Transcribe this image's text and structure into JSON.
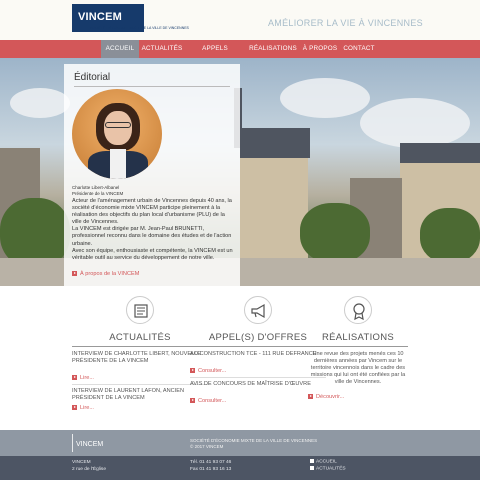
{
  "header": {
    "logo_text": "VINCEM",
    "logo_subtitle": "SOCIÉTÉ D'ÉCONOMIE MIXTE DE LA VILLE DE VINCENNES",
    "tagline": "AMÉLIORER LA VIE À VINCENNES"
  },
  "nav": {
    "items": [
      {
        "label": "ACCUEIL"
      },
      {
        "label": "ACTUALITÉS"
      },
      {
        "label": "APPELS D'OFFRES"
      },
      {
        "label": "RÉALISATIONS"
      },
      {
        "label": "À PROPOS"
      },
      {
        "label": "CONTACT"
      }
    ]
  },
  "editorial": {
    "title": "Éditorial",
    "caption_name": "Charlotte Libert-Albanel",
    "caption_role": "Présidente de la VINCEM",
    "body_1": "Acteur de l'aménagement urbain de Vincennes depuis 40 ans, la société d'économie mixte VINCEM participe pleinement à la réalisation des objectifs du plan local d'urbanisme (PLU) de la ville de Vincennes.",
    "body_2": "La VINCEM est dirigée par M. Jean-Paul BRUNETTI, professionnel reconnu dans le domaine des études et de l'action urbaine.",
    "body_3": "Avec son équipe, enthousiaste et compétente, la VINCEM  est un véritable outil au service du développement de notre ville.",
    "link": "À propos de la VINCEM"
  },
  "columns": {
    "actualites": {
      "title": "ACTUALITÉS",
      "items": [
        {
          "text": "INTERVIEW DE CHARLOTTE LIBERT, NOUVELLE PRÉSIDENTE DE LA VINCEM",
          "link": "Lire..."
        },
        {
          "text": "INTERVIEW DE LAURENT LAFON, ANCIEN PRÉSIDENT DE LA VINCEM",
          "link": "Lire..."
        }
      ]
    },
    "appels": {
      "title": "APPEL(S) D'OFFRES",
      "items": [
        {
          "text": "AO CONSTRUCTION TCE - 111 RUE DEFRANCE",
          "link": "Consulter..."
        },
        {
          "text": "AVIS DE CONCOURS DE MAÎTRISE D'ŒUVRE",
          "link": "Consulter..."
        }
      ]
    },
    "realisations": {
      "title": "RÉALISATIONS",
      "text": "Une revue des projets menés ces 10 dernières années par Vincem sur le territoire vincennois dans le cadre des missions qui lui ont été confiées par la ville de Vincennes.",
      "link": "Découvrir..."
    }
  },
  "footer": {
    "logo_text": "VINCEM",
    "company_line": "SOCIÉTÉ D'ÉCONOMIE MIXTE DE LA VILLE DE VINCENNES",
    "copyright": "© 2017 VINCEM",
    "address_1": "VINCEM",
    "address_2": "2 rue de l'Église",
    "tel": "Tél. 01 41 93 07 46",
    "fax": "Fax 01 41 93 16 13",
    "link_1": "ACCUEIL",
    "link_2": "ACTUALITÉS"
  },
  "colors": {
    "accent": "#d35759",
    "nav_active": "#8a8f98",
    "brand_blue": "#163a6b",
    "footer_top": "#8f98a3",
    "footer_bottom": "#4d5564"
  },
  "icons": [
    "newspaper-icon",
    "megaphone-icon",
    "award-badge-icon",
    "arrow-right-icon",
    "plus-icon"
  ]
}
